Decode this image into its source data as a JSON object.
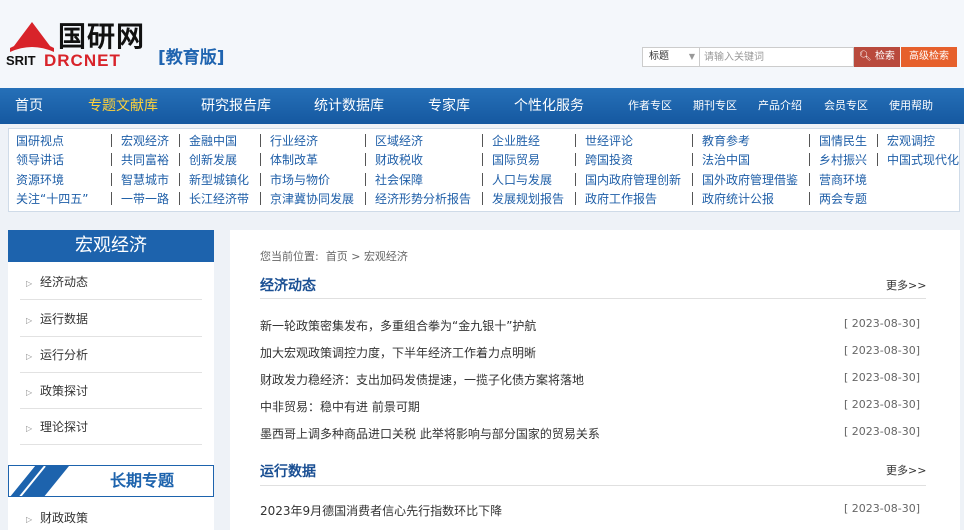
{
  "logo": {
    "cn_name": "国研网",
    "srit": "SRIT",
    "drcnet": "DRCNET",
    "edition": "[教育版]"
  },
  "search": {
    "scope": "标题",
    "placeholder": "请输入关键词",
    "search_label": "检索",
    "advanced_label": "高级检索"
  },
  "nav": {
    "items": [
      "首页",
      "专题文献库",
      "研究报告库",
      "统计数据库",
      "专家库",
      "个性化服务",
      "作者专区",
      "期刊专区",
      "产品介绍",
      "会员专区",
      "使用帮助"
    ],
    "active_index": 1
  },
  "subnav": {
    "rows": [
      [
        "国研视点",
        "宏观经济",
        "金融中国",
        "行业经济",
        "区域经济",
        "企业胜经",
        "世经评论",
        "教育参考",
        "国情民生",
        "宏观调控"
      ],
      [
        "领导讲话",
        "共同富裕",
        "创新发展",
        "体制改革",
        "财政税收",
        "国际贸易",
        "跨国投资",
        "法治中国",
        "乡村振兴",
        "中国式现代化"
      ],
      [
        "资源环境",
        "智慧城市",
        "新型城镇化",
        "市场与物价",
        "社会保障",
        "人口与发展",
        "国内政府管理创新",
        "国外政府管理借鉴",
        "营商环境"
      ],
      [
        "关注“十四五”",
        "一带一路",
        "长江经济带",
        "京津冀协同发展",
        "经济形势分析报告",
        "发展规划报告",
        "政府工作报告",
        "政府统计公报",
        "两会专题"
      ]
    ]
  },
  "sidebar": {
    "title": "宏观经济",
    "items": [
      "经济动态",
      "运行数据",
      "运行分析",
      "政策探讨",
      "理论探讨"
    ],
    "title2": "长期专题",
    "items2": [
      "财政政策"
    ]
  },
  "breadcrumb": {
    "prefix": "您当前位置:",
    "home": "首页",
    "sep": ">",
    "current": "宏观经济"
  },
  "sections": [
    {
      "title": "经济动态",
      "more": "更多>>",
      "news": [
        {
          "title": "新一轮政策密集发布，多重组合拳为“金九银十”护航",
          "date": "[ 2023-08-30]"
        },
        {
          "title": "加大宏观政策调控力度，下半年经济工作着力点明晰",
          "date": "[ 2023-08-30]"
        },
        {
          "title": "财政发力稳经济：支出加码发债提速，一揽子化债方案将落地",
          "date": "[ 2023-08-30]"
        },
        {
          "title": "中非贸易：稳中有进 前景可期",
          "date": "[ 2023-08-30]"
        },
        {
          "title": "墨西哥上调多种商品进口关税 此举将影响与部分国家的贸易关系",
          "date": "[ 2023-08-30]"
        }
      ]
    },
    {
      "title": "运行数据",
      "more": "更多>>",
      "news": [
        {
          "title": "2023年9月德国消费者信心先行指数环比下降",
          "date": "[ 2023-08-30]"
        }
      ]
    }
  ],
  "colors": {
    "nav_bg": "#1d63ad",
    "nav_active": "#ffd23a",
    "brand_red": "#d8232a",
    "link_blue": "#1f5fa8",
    "search_btn": "#b94a3d",
    "adv_btn": "#e6602c"
  }
}
